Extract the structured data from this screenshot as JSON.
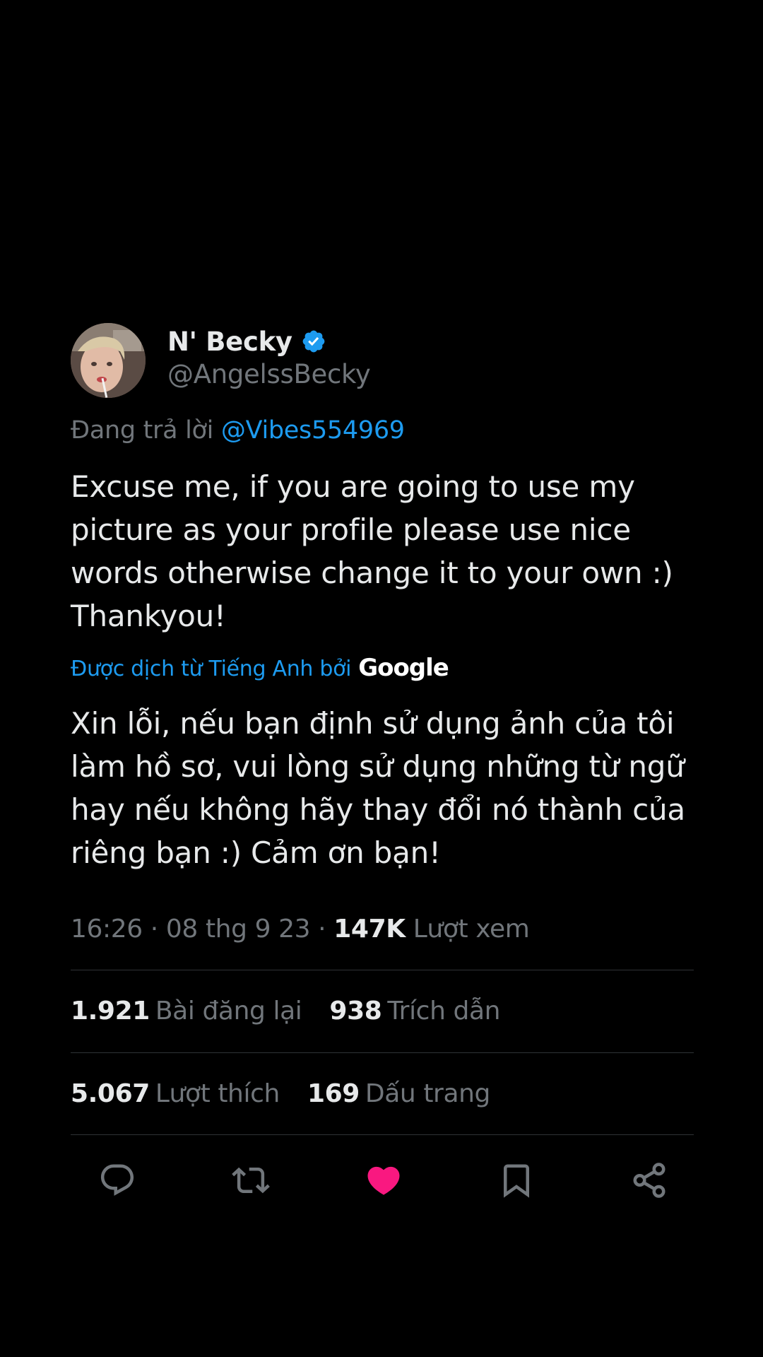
{
  "author": {
    "display_name": "N' Becky",
    "handle": "@AngelssBecky",
    "verified_icon": "verified-badge-icon",
    "verified_color": "#1d9bf0"
  },
  "reply": {
    "prefix": "Đang trả lời ",
    "mention": "@Vibes554969"
  },
  "tweet_text": "Excuse me, if you are going to use my picture as your profile please use nice words otherwise change it to your own :) Thankyou!",
  "translation": {
    "label": "Được dịch từ Tiếng Anh bởi",
    "provider": "Google",
    "text": "Xin lỗi, nếu bạn định sử dụng ảnh của tôi làm hồ sơ, vui lòng sử dụng những từ ngữ hay nếu không hãy thay đổi nó thành của riêng bạn :) Cảm ơn bạn!"
  },
  "meta": {
    "time": "16:26",
    "separator": " · ",
    "date": "08 thg 9 23",
    "views_count": "147K",
    "views_label": " Lượt xem"
  },
  "stats": {
    "reposts": {
      "count": "1.921",
      "label": "Bài đăng lại"
    },
    "quotes": {
      "count": "938",
      "label": "Trích dẫn"
    },
    "likes": {
      "count": "5.067",
      "label": "Lượt thích"
    },
    "bookmarks": {
      "count": "169",
      "label": "Dấu trang"
    }
  },
  "actions": {
    "icons": [
      "reply-icon",
      "repost-icon",
      "like-icon",
      "bookmark-icon",
      "share-icon"
    ],
    "liked": true,
    "like_color": "#f91880",
    "icon_color": "#71767b"
  },
  "colors": {
    "background": "#000000",
    "text_primary": "#e7e9ea",
    "text_secondary": "#71767b",
    "accent": "#1d9bf0",
    "divider": "#2f3336"
  }
}
